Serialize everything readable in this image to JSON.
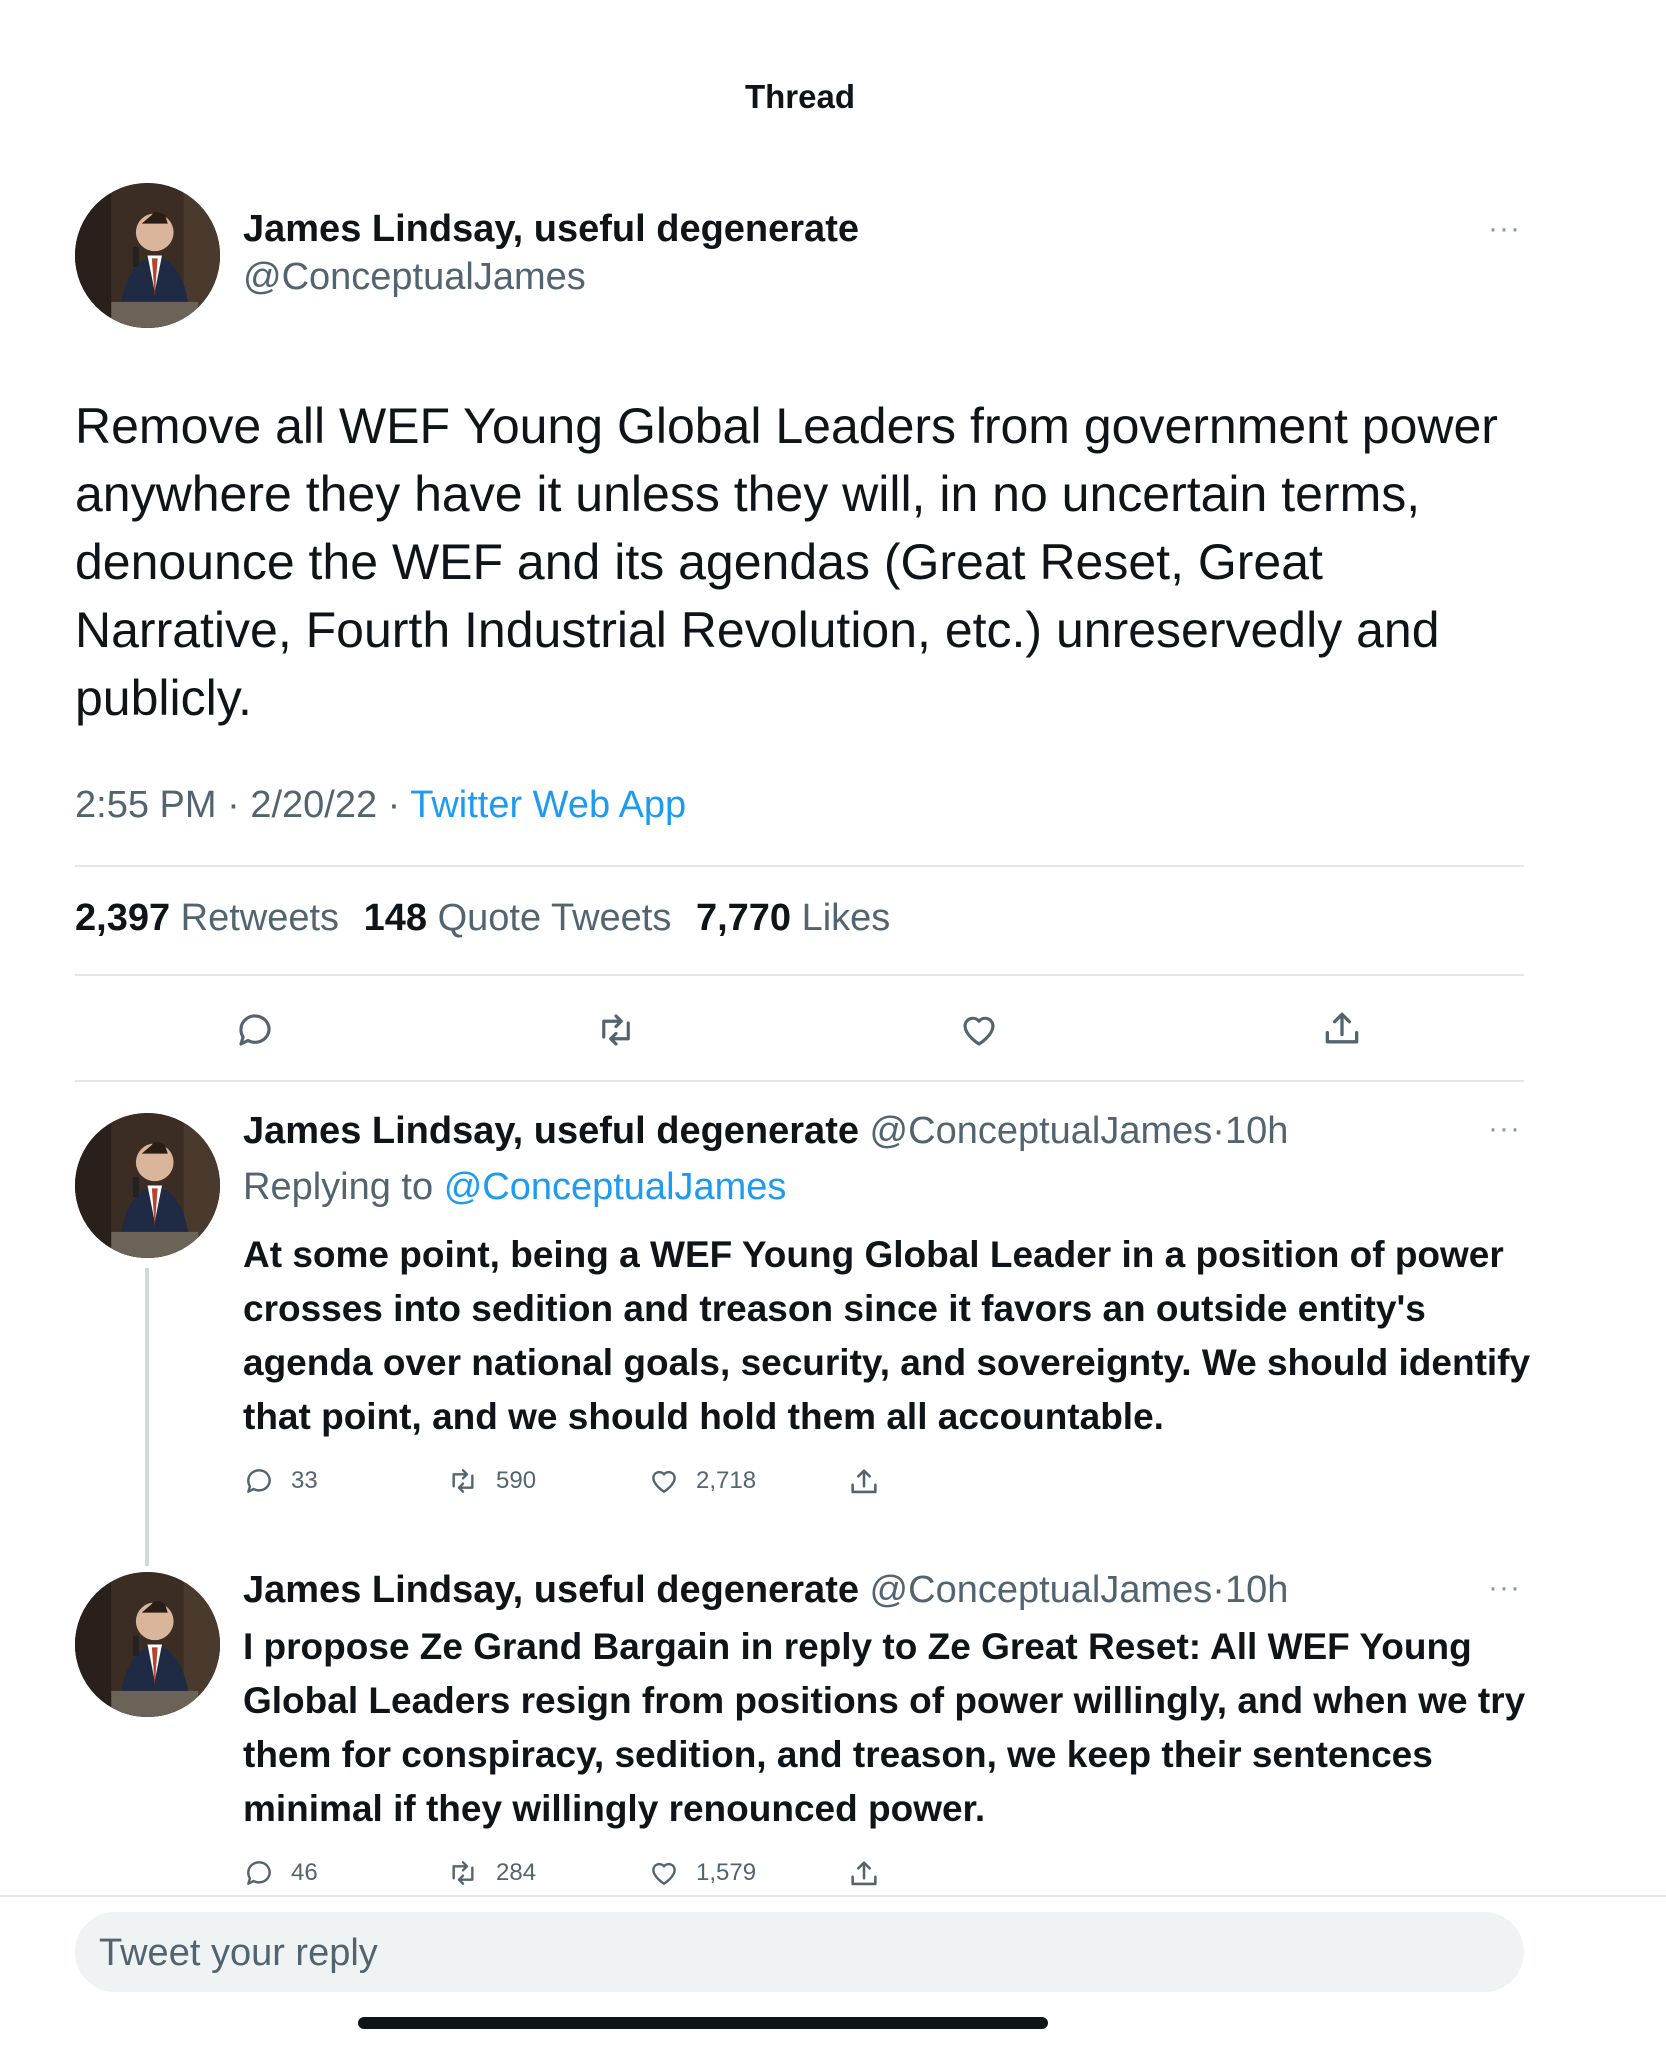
{
  "header": {
    "title": "Thread"
  },
  "main_tweet": {
    "author_name": "James Lindsay, useful degenerate",
    "author_handle": "@ConceptualJames",
    "text": "Remove all WEF Young Global Leaders from government power anywhere they have it unless they will, in no uncertain terms, denounce the WEF and its agendas (Great Reset, Great Narrative, Fourth Industrial Revolution, etc.) unreservedly and publicly.",
    "time": "2:55 PM",
    "date": "2/20/22",
    "source": "Twitter Web App",
    "more": "···",
    "stats": {
      "retweets": "2,397",
      "retweets_label": "Retweets",
      "quotes": "148",
      "quotes_label": "Quote Tweets",
      "likes": "7,770",
      "likes_label": "Likes"
    },
    "action_icons": [
      "reply-icon",
      "retweet-icon",
      "like-icon",
      "share-icon"
    ]
  },
  "replies": [
    {
      "author_name": "James Lindsay, useful degenerate",
      "author_handle": "@ConceptualJames",
      "sep": "·",
      "age": "10h",
      "more": "···",
      "replying_prefix": "Replying to",
      "replying_to": "@ConceptualJames",
      "text": "At some point, being a WEF Young Global Leader in a position of power crosses into sedition and treason since it favors an outside entity's agenda over national goals, security, and sovereignty. We should identify that point, and we should hold them all accountable.",
      "reply_count": "33",
      "retweet_count": "590",
      "like_count": "2,718"
    },
    {
      "author_name": "James Lindsay, useful degenerate",
      "author_handle": "@ConceptualJames",
      "sep": "·",
      "age": "10h",
      "more": "···",
      "text": "I propose Ze Grand Bargain in reply to Ze Great Reset: All WEF Young Global Leaders resign from positions of power willingly, and when we try them for conspiracy, sedition, and treason, we keep their sentences minimal if they willingly renounced power.",
      "reply_count": "46",
      "retweet_count": "284",
      "like_count": "1,579"
    }
  ],
  "composer": {
    "placeholder": "Tweet your reply"
  },
  "colors": {
    "accent": "#1d9bf0",
    "secondary_text": "#536471",
    "primary_text": "#0f1419",
    "divider": "#e3e7ea"
  }
}
